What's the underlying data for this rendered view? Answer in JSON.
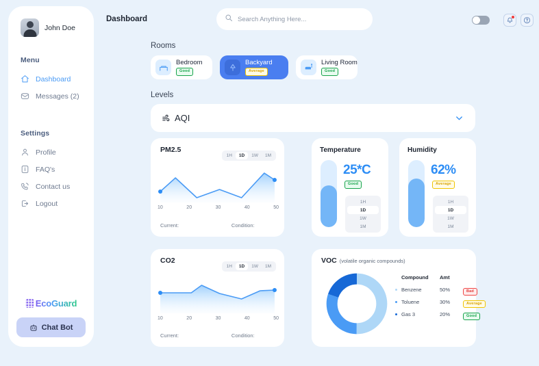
{
  "sidebar": {
    "profile": {
      "name": "John Doe",
      "avatar_icon": "user-avatar"
    },
    "menu_title": "Menu",
    "menu_items": [
      {
        "label": "Dashboard",
        "icon": "home-icon"
      },
      {
        "label": "Messages (2)",
        "icon": "mail-icon"
      }
    ],
    "settings_title": "Settings",
    "settings_items": [
      {
        "label": "Profile",
        "icon": "user-icon"
      },
      {
        "label": "FAQ's",
        "icon": "info-icon"
      },
      {
        "label": "Contact us",
        "icon": "phone-icon"
      },
      {
        "label": "Logout",
        "icon": "logout-icon"
      }
    ],
    "brand": "EcoGuard",
    "chatbot_label": "Chat Bot",
    "chatbot_icon": "robot-icon"
  },
  "header": {
    "title": "Dashboard",
    "search_placeholder": "Search Anything Here...",
    "search_value": "",
    "search_icon": "search-icon",
    "theme_toggle": "off",
    "bell_icon": "notification-bell-icon",
    "help_icon": "help-circle-icon"
  },
  "rooms": {
    "title": "Rooms",
    "items": [
      {
        "name": "Bedroom",
        "status": "Good",
        "status_type": "good",
        "icon": "bed-icon",
        "selected": false
      },
      {
        "name": "Backyard",
        "status": "Average",
        "status_type": "average",
        "icon": "tree-icon",
        "selected": true
      },
      {
        "name": "Living Room",
        "status": "Good",
        "status_type": "good",
        "icon": "sofa-icon",
        "selected": false
      }
    ]
  },
  "levels": {
    "title": "Levels",
    "selected": "AQI",
    "icon": "wind-icon",
    "chevron": "chevron-down-icon"
  },
  "chart_data": [
    {
      "type": "line",
      "title": "PM2.5",
      "ranges": [
        "1H",
        "1D",
        "1W",
        "1M"
      ],
      "selected_range": "1D",
      "x": [
        10,
        15,
        22,
        31,
        40,
        50,
        53
      ],
      "values": [
        18,
        42,
        10,
        22,
        10,
        50,
        40
      ],
      "xlabel": "",
      "ylabel": "",
      "tick_labels": [
        "10",
        "20",
        "30",
        "40",
        "50"
      ],
      "ylim": [
        0,
        60
      ],
      "footer_current": "Current:",
      "footer_condition": "Condition:",
      "line_color": "#4a9bf5"
    },
    {
      "type": "line",
      "title": "CO2",
      "ranges": [
        "1H",
        "1D",
        "1W",
        "1M"
      ],
      "selected_range": "1D",
      "x": [
        10,
        20,
        24,
        31,
        40,
        46,
        53
      ],
      "values": [
        33,
        33,
        46,
        31,
        22,
        36,
        36
      ],
      "xlabel": "",
      "ylabel": "",
      "tick_labels": [
        "10",
        "20",
        "30",
        "40",
        "50"
      ],
      "ylim": [
        0,
        60
      ],
      "footer_current": "Current:",
      "footer_condition": "Condition:",
      "line_color": "#4a9bf5"
    },
    {
      "type": "pie",
      "title": "VOC",
      "subtitle": "(volatile organic compounds)",
      "labels": [
        "Benzene",
        "Toluene",
        "Gas 3"
      ],
      "values": [
        50,
        30,
        20
      ],
      "colors": [
        "#aed7f7",
        "#4a9bf5",
        "#1668d6"
      ],
      "table_headers": [
        "Compound",
        "Amt"
      ],
      "rows": [
        {
          "compound": "Benzene",
          "amt": "50%",
          "status": "Bad",
          "status_type": "bad",
          "color": "#aed7f7"
        },
        {
          "compound": "Toluene",
          "amt": "30%",
          "status": "Average",
          "status_type": "average",
          "color": "#4a9bf5"
        },
        {
          "compound": "Gas  3",
          "amt": "20%",
          "status": "Good",
          "status_type": "good",
          "color": "#1668d6"
        }
      ]
    }
  ],
  "gauges": [
    {
      "title": "Temperature",
      "value": "25*C",
      "status": "Good",
      "status_type": "good",
      "fill_percent": 62,
      "ranges": [
        "1H",
        "1D",
        "1W",
        "1M"
      ],
      "selected_range": "1D"
    },
    {
      "title": "Humidity",
      "value": "62%",
      "status": "Average",
      "status_type": "average",
      "fill_percent": 72,
      "ranges": [
        "1H",
        "1D",
        "1W",
        "1M"
      ],
      "selected_range": "1D"
    }
  ]
}
